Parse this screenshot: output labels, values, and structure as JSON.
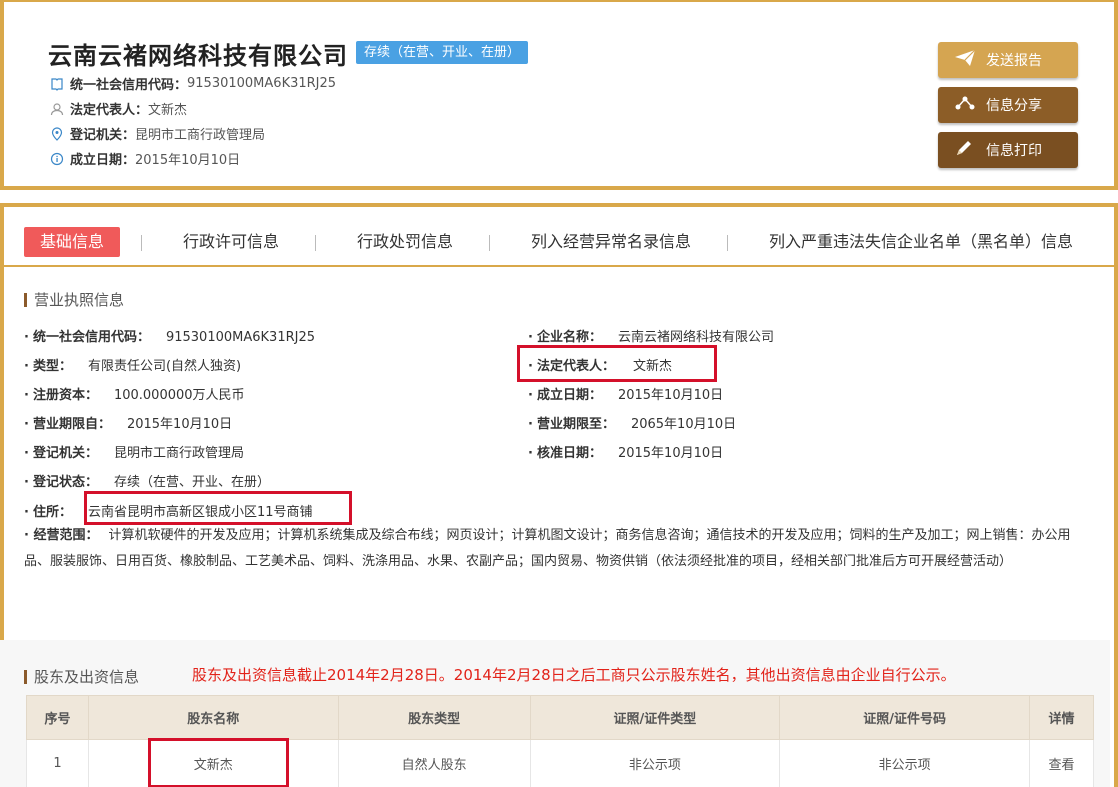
{
  "header": {
    "company_name": "云南云褚网络科技有限公司",
    "status": "存续（在营、开业、在册）",
    "credit_code_label": "统一社会信用代码：",
    "credit_code": "91530100MA6K31RJ25",
    "legal_rep_label": "法定代表人：",
    "legal_rep": "文新杰",
    "registry_label": "登记机关：",
    "registry": "昆明市工商行政管理局",
    "founded_label": "成立日期：",
    "founded": "2015年10月10日",
    "buttons": {
      "send": "发送报告",
      "share": "信息分享",
      "print": "信息打印"
    }
  },
  "tabs": [
    {
      "label": "基础信息"
    },
    {
      "label": "行政许可信息"
    },
    {
      "label": "行政处罚信息"
    },
    {
      "label": "列入经营异常名录信息"
    },
    {
      "label": "列入严重违法失信企业名单（黑名单）信息"
    }
  ],
  "license": {
    "title": "营业执照信息",
    "left": [
      {
        "label": "统一社会信用代码：",
        "value": "91530100MA6K31RJ25"
      },
      {
        "label": "类型：",
        "value": "有限责任公司(自然人独资)"
      },
      {
        "label": "注册资本：",
        "value": "100.000000万人民币"
      },
      {
        "label": "营业期限自：",
        "value": "2015年10月10日"
      },
      {
        "label": "登记机关：",
        "value": "昆明市工商行政管理局"
      },
      {
        "label": "登记状态：",
        "value": "存续（在营、开业、在册）"
      },
      {
        "label": "住所：",
        "value": "云南省昆明市高新区银成小区11号商铺"
      }
    ],
    "right": [
      {
        "label": "企业名称：",
        "value": "云南云褚网络科技有限公司"
      },
      {
        "label": "法定代表人：",
        "value": "文新杰"
      },
      {
        "label": "成立日期：",
        "value": "2015年10月10日"
      },
      {
        "label": "营业期限至：",
        "value": "2065年10月10日"
      },
      {
        "label": "核准日期：",
        "value": "2015年10月10日"
      }
    ],
    "scope_label": "经营范围：",
    "scope": "计算机软硬件的开发及应用；计算机系统集成及综合布线；网页设计；计算机图文设计；商务信息咨询；通信技术的开发及应用；饲料的生产及加工；网上销售：办公用品、服装服饰、日用百货、橡胶制品、工艺美术品、饲料、洗涤用品、水果、农副产品；国内贸易、物资供销（依法须经批准的项目，经相关部门批准后方可开展经营活动）"
  },
  "shareholders": {
    "title": "股东及出资信息",
    "notice": "股东及出资信息截止2014年2月28日。2014年2月28日之后工商只公示股东姓名，其他出资信息由企业自行公示。",
    "columns": [
      "序号",
      "股东名称",
      "股东类型",
      "证照/证件类型",
      "证照/证件号码",
      "详情"
    ],
    "rows": [
      [
        "1",
        "文新杰",
        "自然人股东",
        "非公示项",
        "非公示项",
        "查看"
      ]
    ]
  },
  "colors": {
    "border": "#d9a84a",
    "badge": "#4aa1e3",
    "active_tab": "#f05a5a",
    "highlight": "#d4102a",
    "notice": "#e2231a"
  }
}
